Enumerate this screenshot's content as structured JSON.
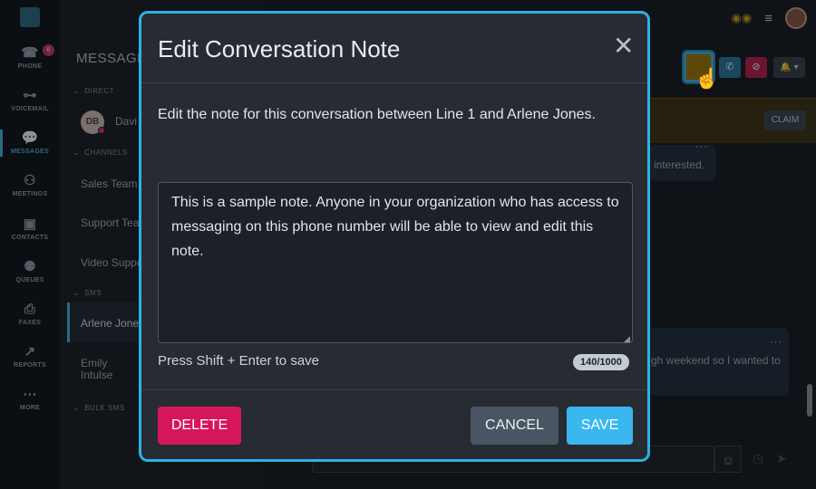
{
  "rail": {
    "badge": "6",
    "items": [
      {
        "label": "PHONE",
        "icon": "phone-icon"
      },
      {
        "label": "VOICEMAIL",
        "icon": "voicemail-icon"
      },
      {
        "label": "MESSAGES",
        "icon": "messages-icon"
      },
      {
        "label": "MEETINGS",
        "icon": "meetings-icon"
      },
      {
        "label": "CONTACTS",
        "icon": "contacts-icon"
      },
      {
        "label": "QUEUES",
        "icon": "queues-icon"
      },
      {
        "label": "FAXES",
        "icon": "faxes-icon"
      },
      {
        "label": "REPORTS",
        "icon": "reports-icon"
      },
      {
        "label": "MORE",
        "icon": "more-icon"
      }
    ]
  },
  "panel": {
    "title": "MESSAGE",
    "sections": {
      "direct": "DIRECT",
      "channels": "CHANNELS",
      "sms": "SMS",
      "bulk_sms": "BULK SMS"
    },
    "direct_avatar": "DB",
    "direct_name": "Davi",
    "channels": [
      "Sales Team",
      "Support Tea",
      "Video Suppo"
    ],
    "sms": [
      "Arlene Jone",
      "Emily\nIntulse"
    ]
  },
  "main": {
    "claim_label": "CLAIM",
    "bubble1_text": "interested.",
    "bubble2_text": "gh weekend so I wanted to"
  },
  "modal": {
    "title": "Edit Conversation Note",
    "description": "Edit the note for this conversation between Line 1 and Arlene Jones.",
    "note_text": "This is a sample note. Anyone in your organization who has access to messaging on this phone number will be able to view and edit this note.",
    "hint": "Press Shift + Enter to save",
    "counter": "140/1000",
    "delete_label": "DELETE",
    "cancel_label": "CANCEL",
    "save_label": "SAVE"
  },
  "colors": {
    "accent": "#2bb3e3",
    "delete": "#d6165a",
    "save": "#3bb7ef"
  }
}
